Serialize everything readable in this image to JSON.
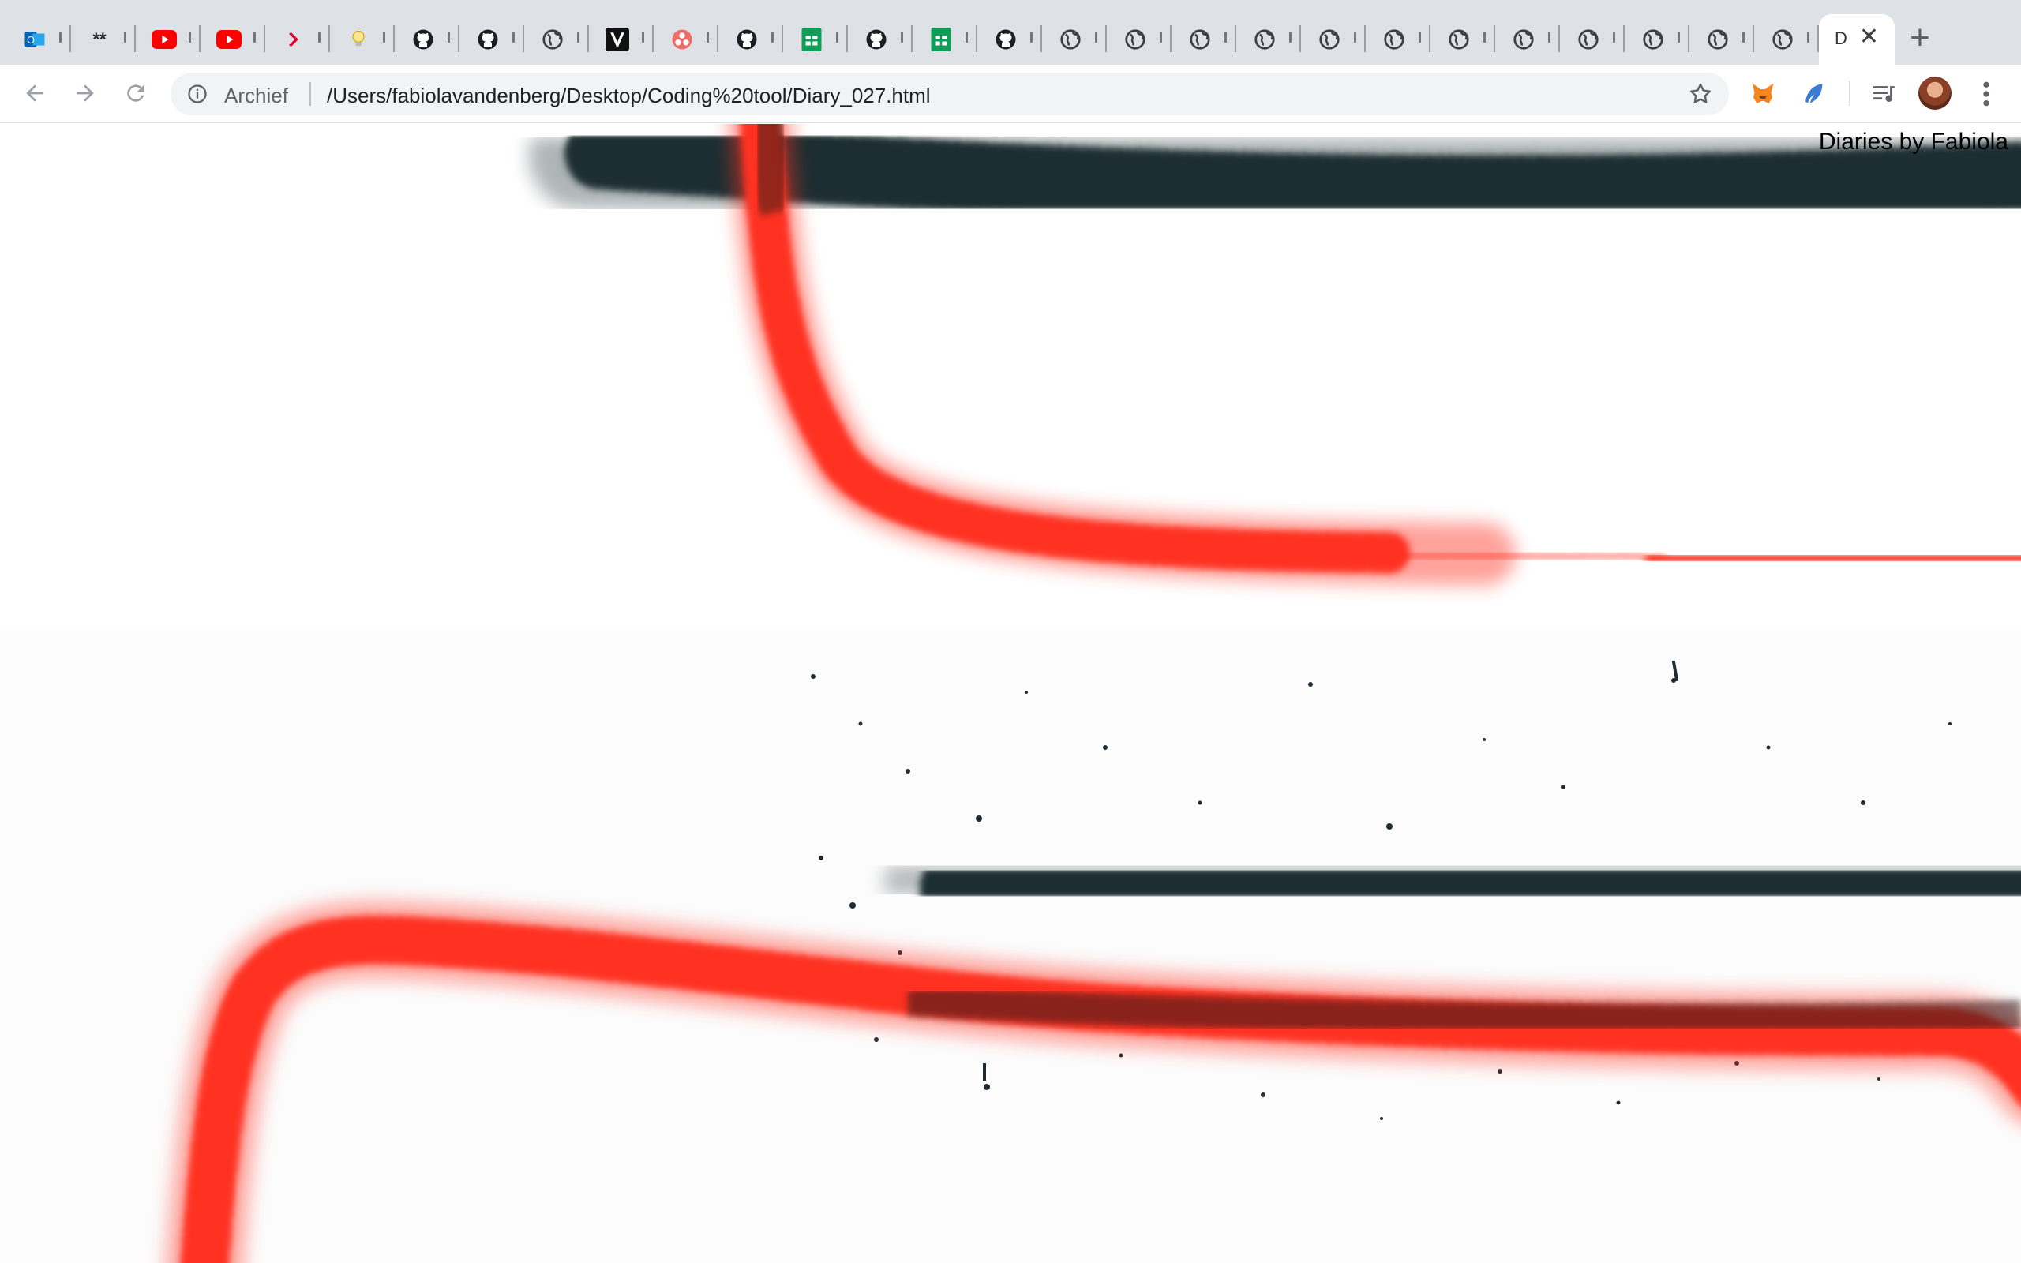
{
  "browser": {
    "tabs": [
      {
        "icon": "outlook-icon"
      },
      {
        "icon": "asterisk-icon",
        "text": "**"
      },
      {
        "icon": "youtube-icon"
      },
      {
        "icon": "youtube-icon"
      },
      {
        "icon": "chevron-right-icon"
      },
      {
        "icon": "lightbulb-icon"
      },
      {
        "icon": "github-icon"
      },
      {
        "icon": "github-icon"
      },
      {
        "icon": "globe-icon"
      },
      {
        "icon": "v-logo-icon"
      },
      {
        "icon": "asana-icon"
      },
      {
        "icon": "github-icon"
      },
      {
        "icon": "sheets-icon"
      },
      {
        "icon": "github-icon"
      },
      {
        "icon": "sheets-icon"
      },
      {
        "icon": "github-icon"
      },
      {
        "icon": "globe-icon"
      },
      {
        "icon": "globe-icon"
      },
      {
        "icon": "globe-icon"
      },
      {
        "icon": "globe-icon"
      },
      {
        "icon": "globe-icon"
      },
      {
        "icon": "globe-icon"
      },
      {
        "icon": "globe-icon"
      },
      {
        "icon": "globe-icon"
      },
      {
        "icon": "globe-icon"
      },
      {
        "icon": "globe-icon"
      },
      {
        "icon": "globe-icon"
      },
      {
        "icon": "globe-icon"
      }
    ],
    "active_tab": {
      "title": "D"
    },
    "new_tab_label": "+",
    "close_label": "✕"
  },
  "toolbar": {
    "scheme_label": "Archief",
    "url": "/Users/fabiolavandenberg/Desktop/Coding%20tool/Diary_027.html"
  },
  "page": {
    "site_title": "Diaries by Fabiola"
  },
  "colors": {
    "tabstrip_bg": "#dee1e6",
    "spray_red": "#ff3322",
    "spray_dark": "#1f2d33",
    "page_bg": "#ffffff"
  }
}
